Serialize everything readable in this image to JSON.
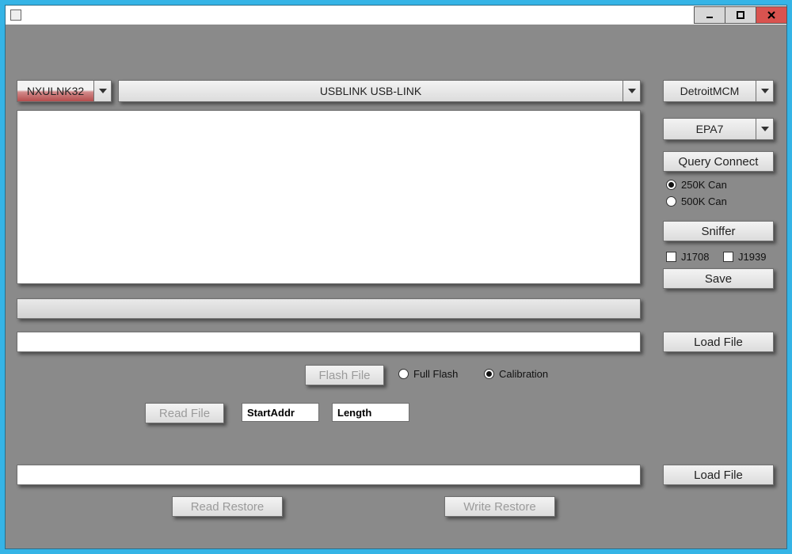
{
  "window": {
    "title": ""
  },
  "top": {
    "adapter_combo": "NXULNK32",
    "device_combo": "USBLINK USB-LINK",
    "ecu_combo": "DetroitMCM"
  },
  "right": {
    "emission_combo": "EPA7",
    "query_btn": "Query Connect",
    "can_radios": {
      "r250": "250K Can",
      "r500": "500K Can"
    },
    "sniffer_btn": "Sniffer",
    "proto_checks": {
      "j1708": "J1708",
      "j1939": "J1939"
    },
    "save_btn": "Save",
    "loadfile1_btn": "Load File",
    "loadfile2_btn": "Load File"
  },
  "center": {
    "progress_bar": "",
    "path_field": "",
    "flash_btn": "Flash File",
    "flash_radios": {
      "full": "Full Flash",
      "cal": "Calibration"
    },
    "read_btn": "Read File",
    "startaddr_label": "StartAddr",
    "length_label": "Length",
    "restore_path": "",
    "read_restore_btn": "Read Restore",
    "write_restore_btn": "Write Restore"
  }
}
